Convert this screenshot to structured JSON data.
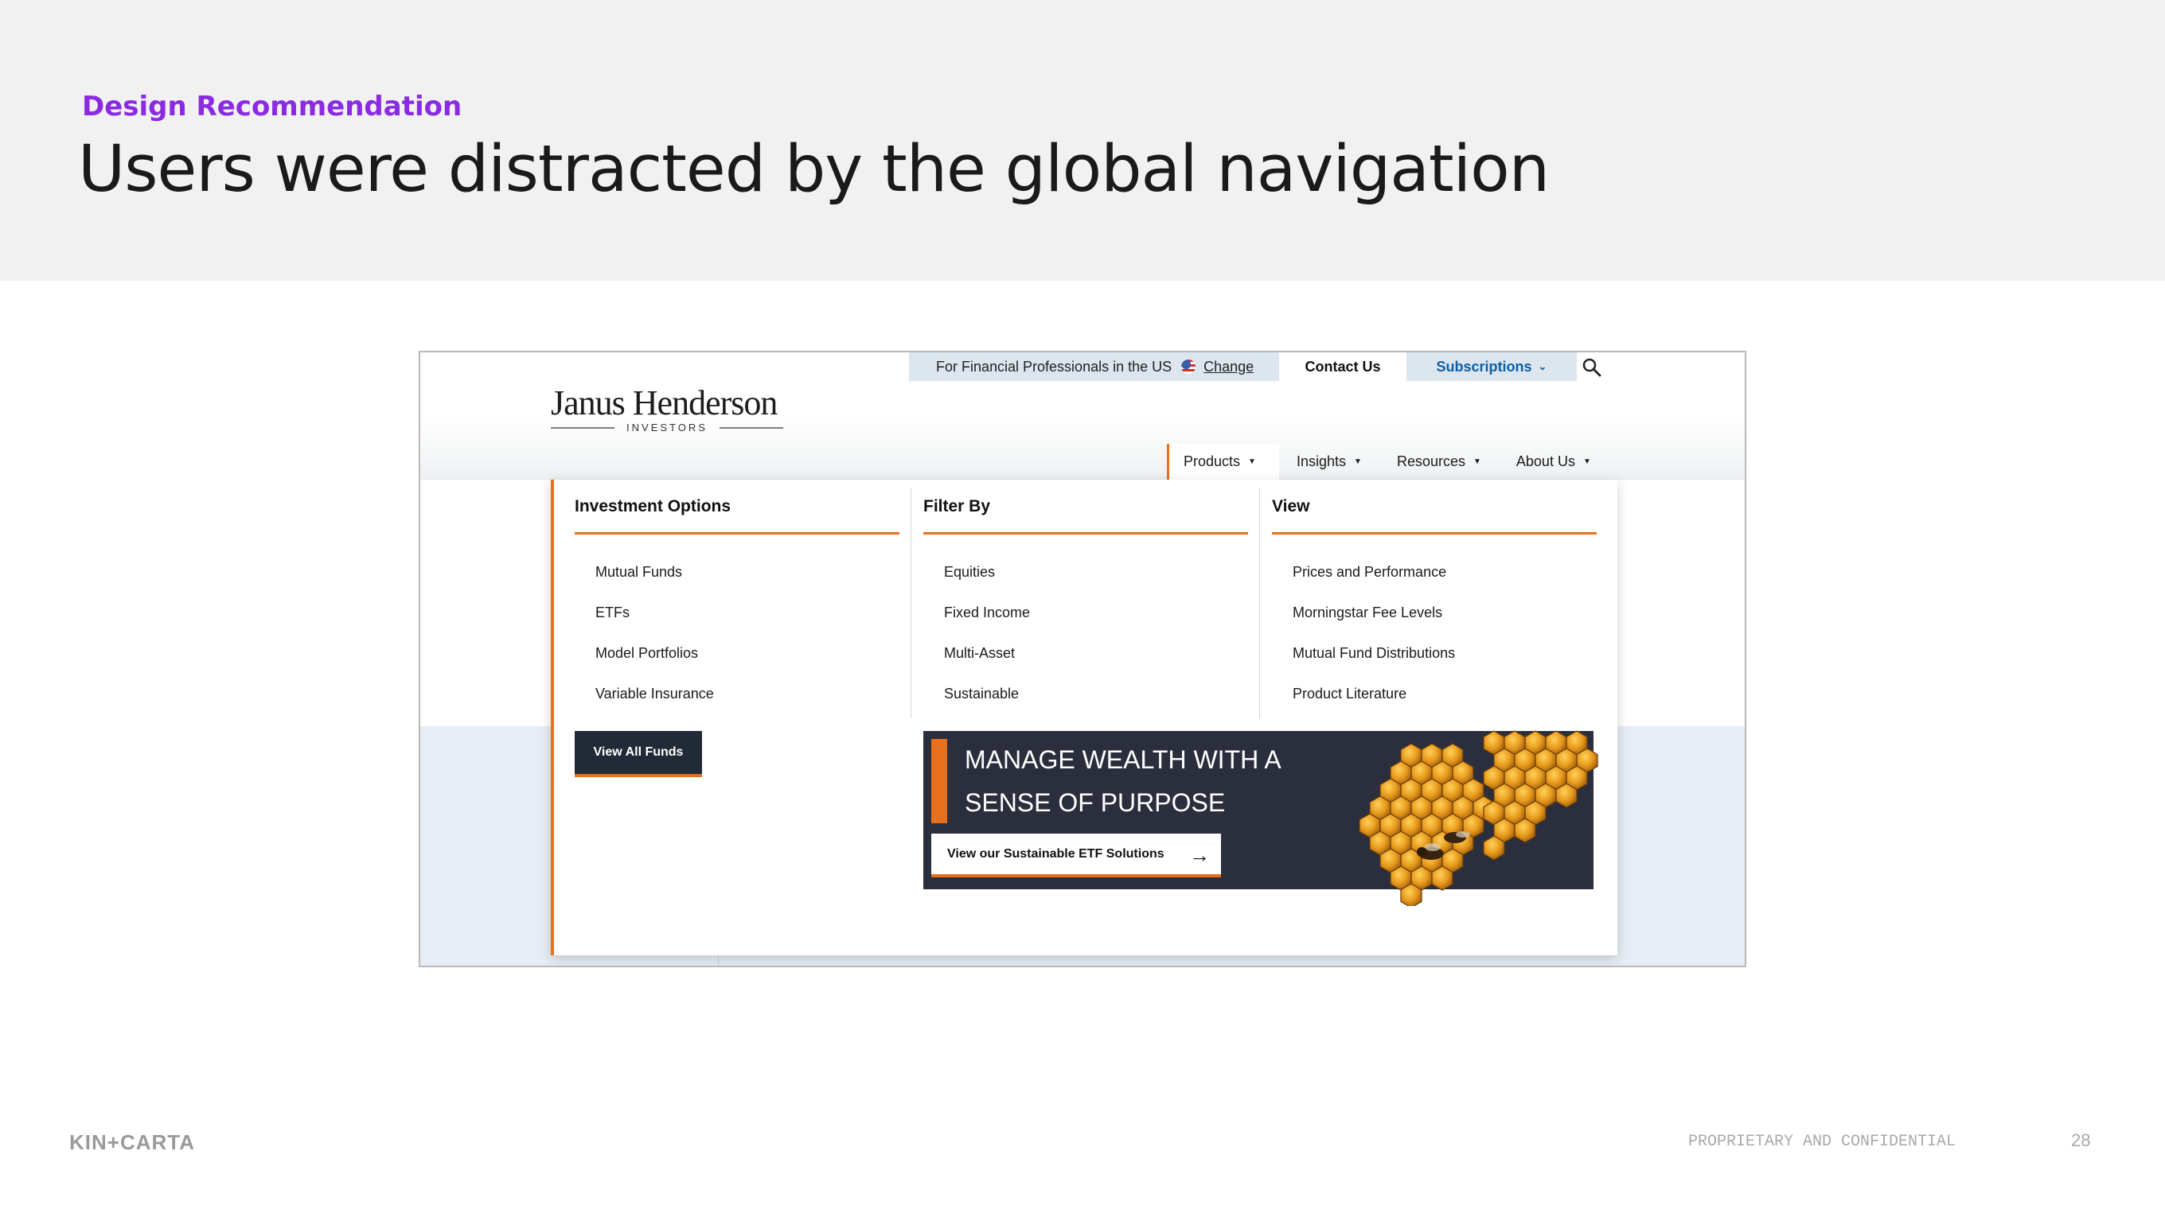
{
  "slide": {
    "eyebrow": "Design Recommendation",
    "title": "Users were distracted by the global navigation",
    "footer_brand": "KIN+CARTA",
    "footer_confidential": "PROPRIETARY AND CONFIDENTIAL",
    "page_number": "28"
  },
  "site": {
    "utility": {
      "audience": "For Financial Professionals in the US",
      "change": "Change",
      "contact": "Contact Us",
      "subscriptions": "Subscriptions"
    },
    "logo": {
      "name": "Janus Henderson",
      "sub": "INVESTORS"
    },
    "nav": {
      "products": "Products",
      "insights": "Insights",
      "resources": "Resources",
      "about": "About Us"
    },
    "dropdown": {
      "columns": [
        {
          "heading": "Investment Options",
          "items": [
            "Mutual Funds",
            "ETFs",
            "Model Portfolios",
            "Variable Insurance"
          ]
        },
        {
          "heading": "Filter By",
          "items": [
            "Equities",
            "Fixed Income",
            "Multi-Asset",
            "Sustainable"
          ]
        },
        {
          "heading": "View",
          "items": [
            "Prices and Performance",
            "Morningstar Fee Levels",
            "Mutual Fund Distributions",
            "Product Literature"
          ]
        }
      ],
      "view_all": "View All Funds",
      "promo": {
        "line1": "MANAGE WEALTH WITH A",
        "line2": "SENSE OF PURPOSE",
        "button": "View our Sustainable ETF Solutions"
      }
    }
  },
  "colors": {
    "accent_orange": "#e8701a",
    "eyebrow_purple": "#8a2be2",
    "promo_navy": "#2b2f3d",
    "link_blue": "#0b5ea8"
  }
}
